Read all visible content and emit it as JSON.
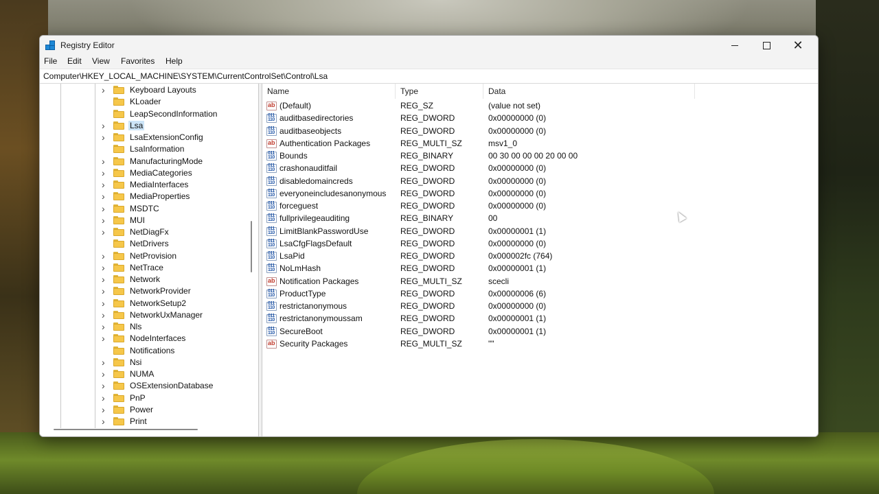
{
  "window": {
    "title": "Registry Editor"
  },
  "window_controls": {
    "minimize": "minimize",
    "maximize": "maximize",
    "close": "close"
  },
  "menu": [
    "File",
    "Edit",
    "View",
    "Favorites",
    "Help"
  ],
  "address": "Computer\\HKEY_LOCAL_MACHINE\\SYSTEM\\CurrentControlSet\\Control\\Lsa",
  "tree": {
    "selected": "Lsa",
    "items": [
      {
        "label": "Keyboard Layouts",
        "expandable": true
      },
      {
        "label": "KLoader",
        "expandable": false
      },
      {
        "label": "LeapSecondInformation",
        "expandable": false
      },
      {
        "label": "Lsa",
        "expandable": true
      },
      {
        "label": "LsaExtensionConfig",
        "expandable": true
      },
      {
        "label": "LsaInformation",
        "expandable": false
      },
      {
        "label": "ManufacturingMode",
        "expandable": true
      },
      {
        "label": "MediaCategories",
        "expandable": true
      },
      {
        "label": "MediaInterfaces",
        "expandable": true
      },
      {
        "label": "MediaProperties",
        "expandable": true
      },
      {
        "label": "MSDTC",
        "expandable": true
      },
      {
        "label": "MUI",
        "expandable": true
      },
      {
        "label": "NetDiagFx",
        "expandable": true
      },
      {
        "label": "NetDrivers",
        "expandable": false
      },
      {
        "label": "NetProvision",
        "expandable": true
      },
      {
        "label": "NetTrace",
        "expandable": true
      },
      {
        "label": "Network",
        "expandable": true
      },
      {
        "label": "NetworkProvider",
        "expandable": true
      },
      {
        "label": "NetworkSetup2",
        "expandable": true
      },
      {
        "label": "NetworkUxManager",
        "expandable": true
      },
      {
        "label": "Nls",
        "expandable": true
      },
      {
        "label": "NodeInterfaces",
        "expandable": true
      },
      {
        "label": "Notifications",
        "expandable": false
      },
      {
        "label": "Nsi",
        "expandable": true
      },
      {
        "label": "NUMA",
        "expandable": true
      },
      {
        "label": "OSExtensionDatabase",
        "expandable": true
      },
      {
        "label": "PnP",
        "expandable": true
      },
      {
        "label": "Power",
        "expandable": true
      },
      {
        "label": "Print",
        "expandable": true
      }
    ]
  },
  "columns": {
    "name": "Name",
    "type": "Type",
    "data": "Data"
  },
  "values": [
    {
      "icon": "string-value-icon",
      "name": "(Default)",
      "type": "REG_SZ",
      "data": "(value not set)"
    },
    {
      "icon": "binary-value-icon",
      "name": "auditbasedirectories",
      "type": "REG_DWORD",
      "data": "0x00000000 (0)"
    },
    {
      "icon": "binary-value-icon",
      "name": "auditbaseobjects",
      "type": "REG_DWORD",
      "data": "0x00000000 (0)"
    },
    {
      "icon": "string-value-icon",
      "name": "Authentication Packages",
      "type": "REG_MULTI_SZ",
      "data": "msv1_0"
    },
    {
      "icon": "binary-value-icon",
      "name": "Bounds",
      "type": "REG_BINARY",
      "data": "00 30 00 00 00 20 00 00"
    },
    {
      "icon": "binary-value-icon",
      "name": "crashonauditfail",
      "type": "REG_DWORD",
      "data": "0x00000000 (0)"
    },
    {
      "icon": "binary-value-icon",
      "name": "disabledomaincreds",
      "type": "REG_DWORD",
      "data": "0x00000000 (0)"
    },
    {
      "icon": "binary-value-icon",
      "name": "everyoneincludesanonymous",
      "type": "REG_DWORD",
      "data": "0x00000000 (0)"
    },
    {
      "icon": "binary-value-icon",
      "name": "forceguest",
      "type": "REG_DWORD",
      "data": "0x00000000 (0)"
    },
    {
      "icon": "binary-value-icon",
      "name": "fullprivilegeauditing",
      "type": "REG_BINARY",
      "data": "00"
    },
    {
      "icon": "binary-value-icon",
      "name": "LimitBlankPasswordUse",
      "type": "REG_DWORD",
      "data": "0x00000001 (1)"
    },
    {
      "icon": "binary-value-icon",
      "name": "LsaCfgFlagsDefault",
      "type": "REG_DWORD",
      "data": "0x00000000 (0)"
    },
    {
      "icon": "binary-value-icon",
      "name": "LsaPid",
      "type": "REG_DWORD",
      "data": "0x000002fc (764)"
    },
    {
      "icon": "binary-value-icon",
      "name": "NoLmHash",
      "type": "REG_DWORD",
      "data": "0x00000001 (1)"
    },
    {
      "icon": "string-value-icon",
      "name": "Notification Packages",
      "type": "REG_MULTI_SZ",
      "data": "scecli"
    },
    {
      "icon": "binary-value-icon",
      "name": "ProductType",
      "type": "REG_DWORD",
      "data": "0x00000006 (6)"
    },
    {
      "icon": "binary-value-icon",
      "name": "restrictanonymous",
      "type": "REG_DWORD",
      "data": "0x00000000 (0)"
    },
    {
      "icon": "binary-value-icon",
      "name": "restrictanonymoussam",
      "type": "REG_DWORD",
      "data": "0x00000001 (1)"
    },
    {
      "icon": "binary-value-icon",
      "name": "SecureBoot",
      "type": "REG_DWORD",
      "data": "0x00000001 (1)"
    },
    {
      "icon": "string-value-icon",
      "name": "Security Packages",
      "type": "REG_MULTI_SZ",
      "data": "\"\""
    }
  ],
  "icons": {
    "string": "ab",
    "binary": "011\n110"
  },
  "colors": {
    "selection": "#cce4f7",
    "folder": "#f6c74a"
  }
}
